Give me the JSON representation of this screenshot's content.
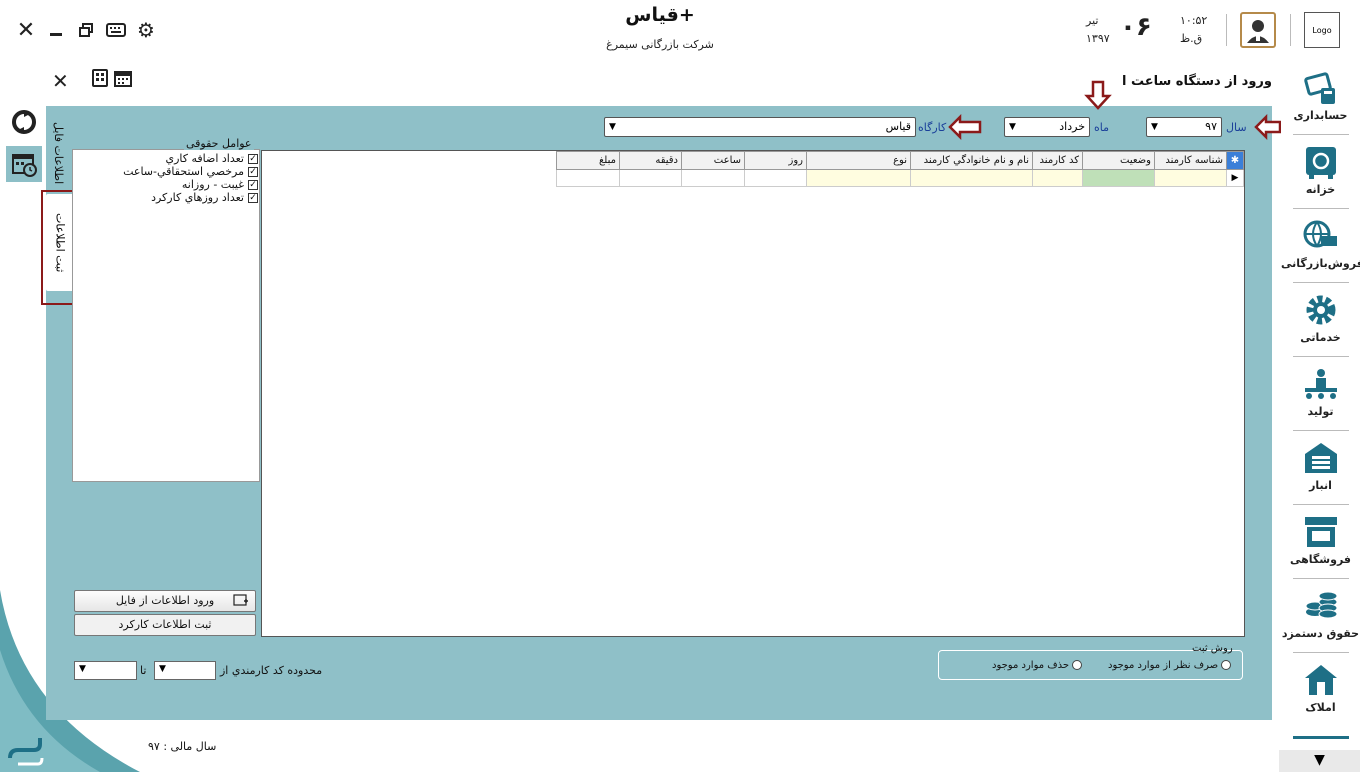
{
  "app": {
    "title": "قیاس+",
    "company": "شرکت بازرگانی سیمرغ",
    "logo": "Logo"
  },
  "header": {
    "time": "۱۰:۵۲",
    "ampm": "ق.ظ",
    "day": "۰۶",
    "month": "تیر",
    "year": "۱۳۹۷"
  },
  "page": {
    "title": "ورود از دستگاه ساعت ا"
  },
  "nav": {
    "items": [
      {
        "label": "حسابداری",
        "icon": "accounting-icon"
      },
      {
        "label": "خزانه",
        "icon": "treasury-icon"
      },
      {
        "label": "فروش‌بازرگانی",
        "icon": "commerce-sales-icon"
      },
      {
        "label": "خدماتی",
        "icon": "services-gear-icon"
      },
      {
        "label": "تولید",
        "icon": "production-icon"
      },
      {
        "label": "انبار",
        "icon": "warehouse-icon"
      },
      {
        "label": "فروشگاهی",
        "icon": "store-icon"
      },
      {
        "label": "حقوق دستمزد",
        "icon": "payroll-coins-icon"
      },
      {
        "label": "املاک",
        "icon": "realestate-icon"
      }
    ]
  },
  "tabs": {
    "file_info": "اطلاعات فایل",
    "register_info": "ثبت اطلاعات"
  },
  "filters": {
    "year_label": "سال",
    "year_value": "۹۷",
    "month_label": "ماه",
    "month_value": "خرداد",
    "workshop_label": "کارگاه",
    "workshop_value": "قیاس"
  },
  "factors": {
    "title": "عوامل حقوقی",
    "items": [
      {
        "label": "تعداد اضافه كاري",
        "checked": true
      },
      {
        "label": "مرخصي استحقاقي-ساعت",
        "checked": true
      },
      {
        "label": "غيبت - روزانه",
        "checked": true
      },
      {
        "label": "تعداد روزهاي كاركرد",
        "checked": true
      }
    ]
  },
  "grid": {
    "columns": [
      "شناسه کارمند",
      "وضعیت",
      "کد کارمند",
      "نام و نام خانوادگي کارمند",
      "نوع",
      "روز",
      "ساعت",
      "دقیقه",
      "مبلغ"
    ]
  },
  "buttons": {
    "import_file": "ورود اطلاعات از فایل",
    "register_work": "ثبت اطلاعات کارکرد"
  },
  "range": {
    "label": "محدوده کد کارمندي از",
    "to": "تا"
  },
  "method": {
    "title": "روش ثبت",
    "option1": "صرف نظر از موارد موجود",
    "option2": "حذف موارد موجود"
  },
  "footer": {
    "fiscal_year": "سال مالی : ۹۷"
  },
  "colors": {
    "panel": "#8fc0c8",
    "accent": "#1e6f86",
    "highlight_red": "#8b1a1a"
  }
}
